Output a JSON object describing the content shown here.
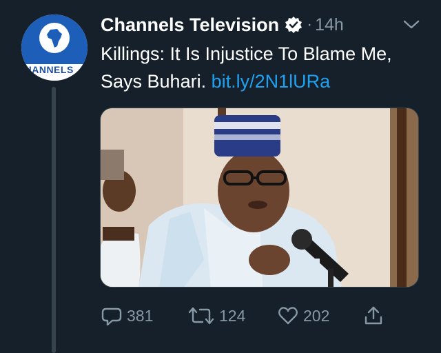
{
  "tweet": {
    "author_name": "Channels Television",
    "avatar_logo_text": "CHANNELS",
    "timestamp": "14h",
    "dot": "·",
    "text_main": "Killings: It Is Injustice To Blame Me, Says Buhari. ",
    "link_text": "bit.ly/2N1lURa"
  },
  "actions": {
    "replies": "381",
    "retweets": "124",
    "likes": "202"
  },
  "colors": {
    "background": "#15202b",
    "link": "#1da1f2",
    "muted": "#8899a6"
  }
}
